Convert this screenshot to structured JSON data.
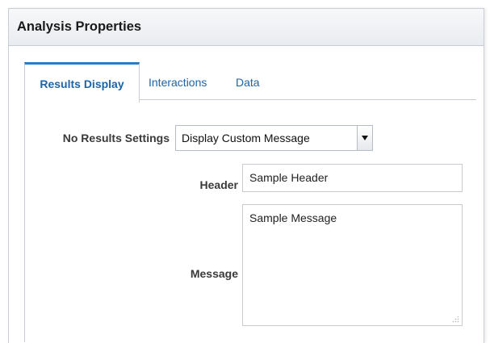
{
  "dialog": {
    "title": "Analysis Properties"
  },
  "tabs": [
    {
      "label": "Results Display",
      "active": true
    },
    {
      "label": "Interactions",
      "active": false
    },
    {
      "label": "Data",
      "active": false
    }
  ],
  "form": {
    "no_results_label": "No Results Settings",
    "no_results_value": "Display Custom Message",
    "header_label": "Header",
    "header_value": "Sample Header",
    "message_label": "Message",
    "message_value": "Sample Message"
  },
  "icons": {
    "dropdown": "chevron-down-icon",
    "resize": "resize-grip-icon"
  },
  "colors": {
    "tab_text": "#1d64a6",
    "tab_active_border": "#2a7dc4",
    "label_text": "#3a3a3a"
  }
}
